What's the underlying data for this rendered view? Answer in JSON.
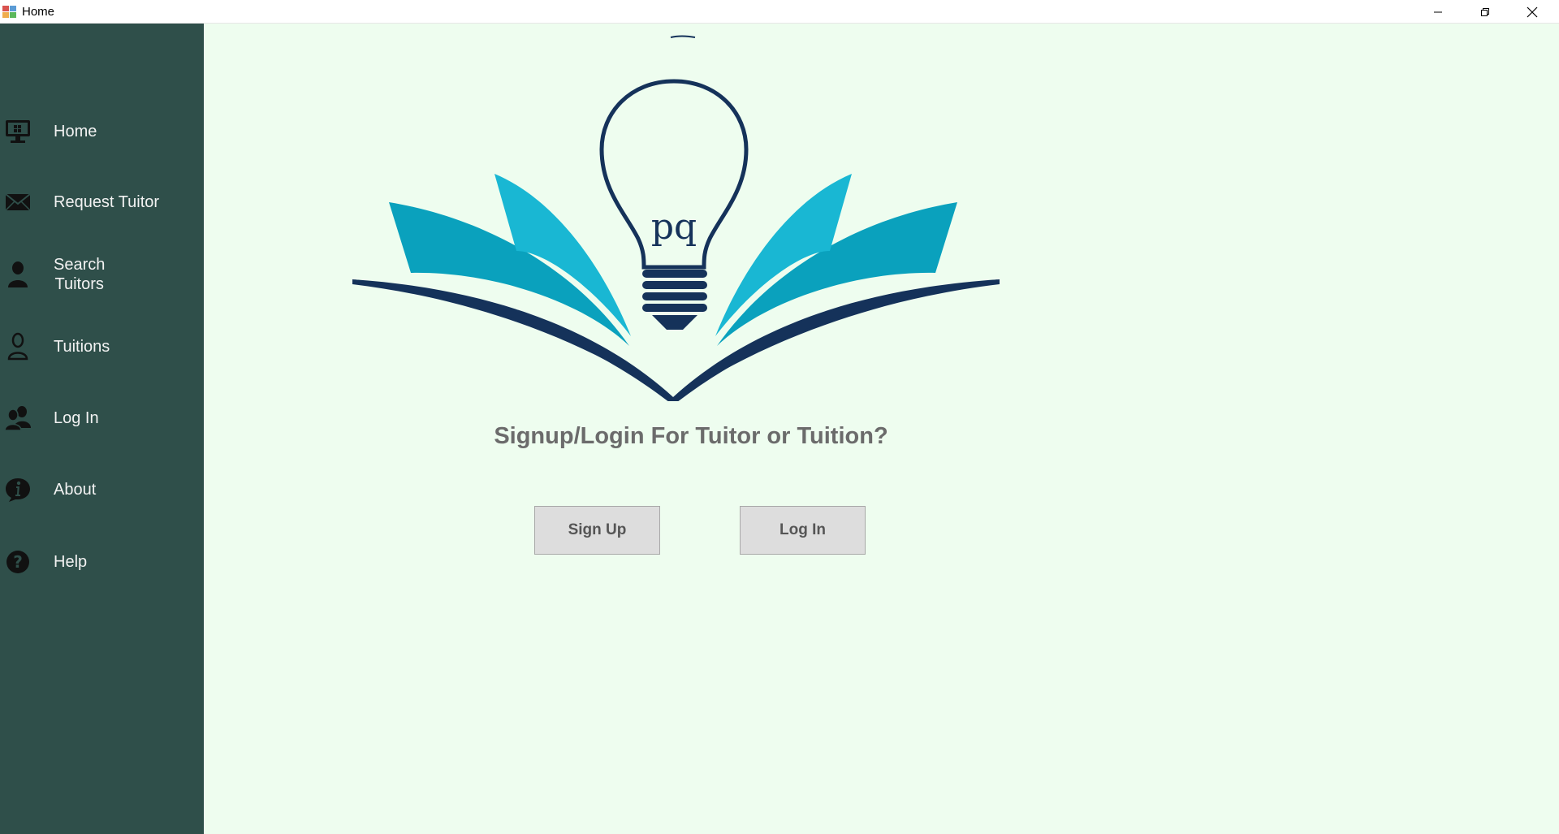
{
  "window": {
    "title": "Home",
    "icon": "app-icon"
  },
  "sidebar": {
    "background": "#2f4f4a",
    "items": [
      {
        "id": "home",
        "label": "Home",
        "icon": "monitor-icon"
      },
      {
        "id": "request-tutor",
        "label": "Request Tuitor",
        "icon": "envelope-icon"
      },
      {
        "id": "search-tutors",
        "label_line1": "Search",
        "label_line2": "Tuitors",
        "icon": "user-silhouette-icon"
      },
      {
        "id": "tuitions",
        "label": "Tuitions",
        "icon": "user-outline-icon"
      },
      {
        "id": "log-in",
        "label": "Log In",
        "icon": "users-icon"
      },
      {
        "id": "about",
        "label": "About",
        "icon": "info-icon"
      },
      {
        "id": "help",
        "label": "Help",
        "icon": "help-icon"
      }
    ]
  },
  "main": {
    "background": "#eefdef",
    "logo": {
      "icon": "book-lightbulb-logo",
      "letters": "pq"
    },
    "prompt": "Signup/Login For Tuitor or Tuition?",
    "buttons": {
      "signup": "Sign Up",
      "login": "Log In"
    }
  },
  "colors": {
    "logo_dark": "#15325a",
    "logo_teal": "#0aa1bd",
    "logo_light_teal": "#19b7d3",
    "prompt_text": "#6b6b6b"
  }
}
